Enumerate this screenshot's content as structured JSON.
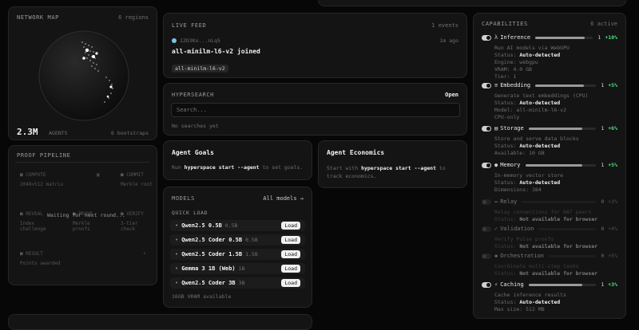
{
  "network_map": {
    "title": "NETWORK MAP",
    "regions": "6 regions",
    "agents_count": "2.3M",
    "agents_label": "AGENTS",
    "bootstraps": "6 bootstraps"
  },
  "proof_pipeline": {
    "title": "PROOF PIPELINE",
    "compute": {
      "label": "COMPUTE",
      "desc": "2048×512 matrix"
    },
    "commit": {
      "label": "COMMIT",
      "desc": "Merkle root"
    },
    "reveal": {
      "label": "REVEAL",
      "desc": "Index challenge"
    },
    "prove": {
      "label": "PROVE",
      "desc": "Merkle proofs"
    },
    "verify": {
      "label": "VERIFY",
      "desc": "3-tier check"
    },
    "overlay": "Waiting for next round...",
    "result": {
      "label": "RESULT",
      "desc": "Points awarded"
    }
  },
  "live_feed": {
    "title": "LIVE FEED",
    "count": "1 events",
    "peer": "12D3Ko...nLq5",
    "time": "1m ago",
    "message": "all-minilm-l6-v2 joined",
    "tag": "all-minilm-l6-v2"
  },
  "hypersearch": {
    "title": "HYPERSEARCH",
    "open": "Open",
    "placeholder": "Search...",
    "empty": "No searches yet"
  },
  "agent_goals": {
    "title": "Agent Goals",
    "pre": "Run",
    "cmd": "hyperspace start --agent",
    "post": "to set goals."
  },
  "agent_economics": {
    "title": "Agent Economics",
    "pre": "Start with",
    "cmd": "hyperspace start --agent",
    "post": "to track economics."
  },
  "models": {
    "title": "MODELS",
    "all": "All models →",
    "quick": "QUICK LOAD",
    "load_label": "Load",
    "items": [
      {
        "name": "Qwen2.5 0.5B",
        "size": "0.5B"
      },
      {
        "name": "Qwen2.5 Coder 0.5B",
        "size": "0.5B"
      },
      {
        "name": "Qwen2.5 Coder 1.5B",
        "size": "1.5B"
      },
      {
        "name": "Gemma 3 1B (Web)",
        "size": "1B"
      },
      {
        "name": "Qwen2.5 Coder 3B",
        "size": "3B"
      }
    ],
    "vram": "16GB VRAM available"
  },
  "capabilities": {
    "title": "CAPABILITIES",
    "active": "6 active",
    "items": [
      {
        "icon": "λ",
        "name": "Inference",
        "count": "1",
        "delta": "+10%",
        "fill": 0.85,
        "on": true,
        "lines": [
          "Run AI models via WebGPU"
        ],
        "status_label": "Status:",
        "status": "Auto-detected",
        "extra": [
          "Engine: webgpu",
          "VRAM: 4.0 GB",
          "Tier: 1"
        ]
      },
      {
        "icon": "≡",
        "name": "Embedding",
        "count": "1",
        "delta": "+5%",
        "fill": 0.8,
        "on": true,
        "lines": [
          "Generate text embeddings (CPU)"
        ],
        "status_label": "Status:",
        "status": "Auto-detected",
        "extra": [
          "Model: all-minilm-l6-v2",
          "CPU-only"
        ]
      },
      {
        "icon": "▤",
        "name": "Storage",
        "count": "1",
        "delta": "+6%",
        "fill": 0.8,
        "on": true,
        "lines": [
          "Store and serve data blocks"
        ],
        "status_label": "Status:",
        "status": "Auto-detected",
        "extra": [
          "Available: 10 GB"
        ]
      },
      {
        "icon": "●",
        "name": "Memory",
        "count": "1",
        "delta": "+5%",
        "fill": 0.8,
        "on": true,
        "lines": [
          "In-memory vector store"
        ],
        "status_label": "Status:",
        "status": "Auto-detected",
        "extra": [
          "Dimensions: 384"
        ]
      },
      {
        "icon": "↔",
        "name": "Relay",
        "count": "0",
        "delta": "+3%",
        "fill": 0,
        "on": false,
        "lines": [
          "Relay connections for NAT peers"
        ],
        "status_label": "Status:",
        "status": "Not available for browser",
        "extra": []
      },
      {
        "icon": "✓",
        "name": "Validation",
        "count": "0",
        "delta": "+4%",
        "fill": 0,
        "on": false,
        "lines": [
          "Verify Pulse proofs"
        ],
        "status_label": "Status:",
        "status": "Not available for browser",
        "extra": []
      },
      {
        "icon": "◆",
        "name": "Orchestration",
        "count": "0",
        "delta": "+5%",
        "fill": 0,
        "on": false,
        "lines": [
          "Coordinate multi-step tasks"
        ],
        "status_label": "Status:",
        "status": "Not available for browser",
        "extra": []
      },
      {
        "icon": "⚡",
        "name": "Caching",
        "count": "1",
        "delta": "+3%",
        "fill": 0.8,
        "on": true,
        "lines": [
          "Cache inference results"
        ],
        "status_label": "Status:",
        "status": "Auto-detected",
        "extra": [
          "Max size: 512 MB"
        ]
      }
    ]
  }
}
